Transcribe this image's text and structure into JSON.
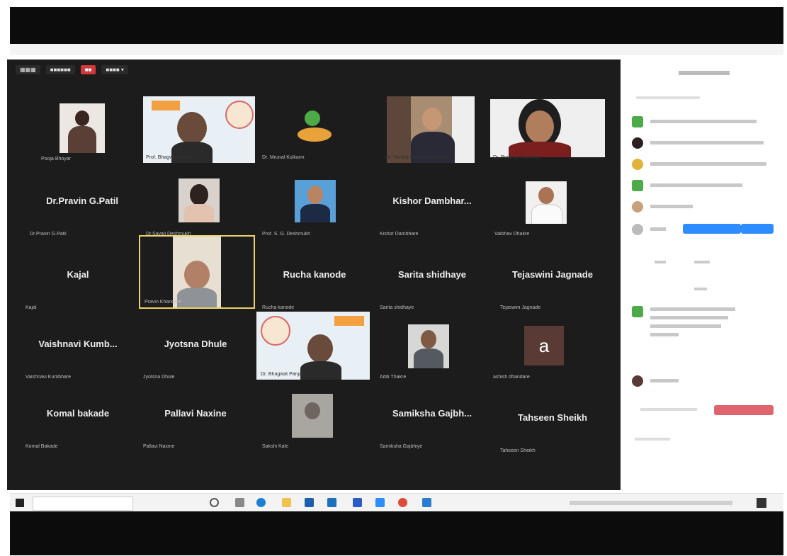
{
  "tiles": [
    {
      "name": "",
      "label": "Pooja Bhoyar"
    },
    {
      "name": "",
      "label": "Prof. Bhagwat Panjab"
    },
    {
      "name": "",
      "label": "Dr. Mrunal Kulkarni"
    },
    {
      "name": "",
      "label": "Dr. Varsha Kulkarni Vaishnav"
    },
    {
      "name": "",
      "label": "Dr. Pradnya Dandekar"
    },
    {
      "name": "Dr.Pravin G.Patil",
      "label": "Dr.Pravin G.Patil"
    },
    {
      "name": "",
      "label": "Dr.Sayali Deshmukh"
    },
    {
      "name": "",
      "label": "Prof. S. G. Deshmukh"
    },
    {
      "name": "Kishor  Dambhar...",
      "label": "Kishor Dambhare"
    },
    {
      "name": "",
      "label": "Vaibhav Dhakre"
    },
    {
      "name": "Kajal",
      "label": "Kajal"
    },
    {
      "name": "",
      "label": "Pravin Khandare"
    },
    {
      "name": "Rucha kanode",
      "label": "Rucha kanode"
    },
    {
      "name": "Sarita shidhaye",
      "label": "Sarita shidhaye"
    },
    {
      "name": "Tejaswini Jagnade",
      "label": "Tejaswini Jagnade"
    },
    {
      "name": "Vaishnavi  Kumb...",
      "label": "Vaishnavi Kumbhare"
    },
    {
      "name": "Jyotsna Dhule",
      "label": "Jyotsna Dhule"
    },
    {
      "name": "",
      "label": "Dr. Bhagwat Panjab"
    },
    {
      "name": "",
      "label": "Aditi Thakre"
    },
    {
      "name": "",
      "label": "ashish dhandare"
    },
    {
      "name": "Komal bakade",
      "label": "Komal Bakade"
    },
    {
      "name": "Pallavi Naxine",
      "label": "Pallavi Naxine"
    },
    {
      "name": "",
      "label": "Sakshi Kale"
    },
    {
      "name": "Samiksha  Gajbh...",
      "label": "Samiksha Gajbhiye"
    },
    {
      "name": "Tahseen Sheikh",
      "label": "Tahseen Sheikh"
    }
  ],
  "avatar_letter": "a",
  "colors": {
    "gallery_bg": "#1c1c1c",
    "panel_blue": "#2d8cff",
    "panel_red": "#e0646e",
    "active_border": "#e8d36a"
  }
}
